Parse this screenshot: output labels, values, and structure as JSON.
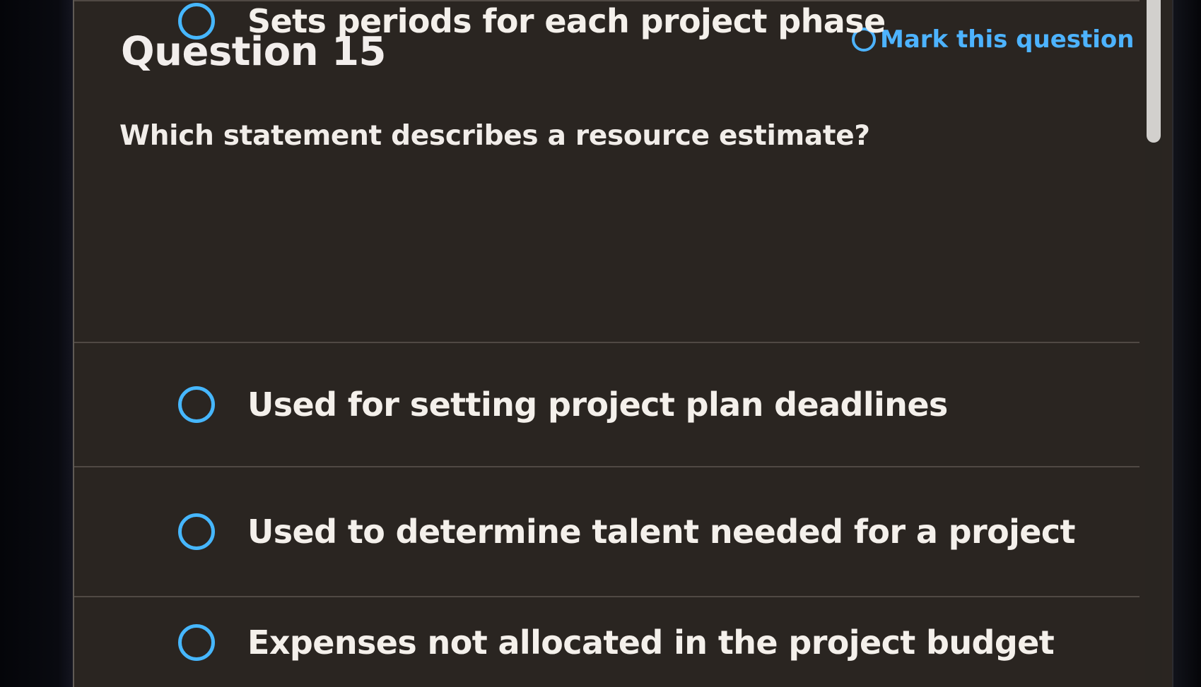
{
  "question": {
    "title": "Question 15",
    "mark_label": "Mark this question",
    "prompt": "Which statement describes a resource estimate?"
  },
  "options": [
    {
      "label": "Used for setting project plan deadlines"
    },
    {
      "label": "Used to determine talent needed for a project"
    },
    {
      "label": "Expenses not allocated in the project budget"
    },
    {
      "label": "Sets periods for each project phase"
    }
  ],
  "icons": {
    "mark": "circle-outline-icon",
    "radio": "radio-unselected-icon"
  },
  "colors": {
    "accent": "#4db3ff",
    "panel_background": "#2a2521",
    "text": "#f4f0eb"
  }
}
